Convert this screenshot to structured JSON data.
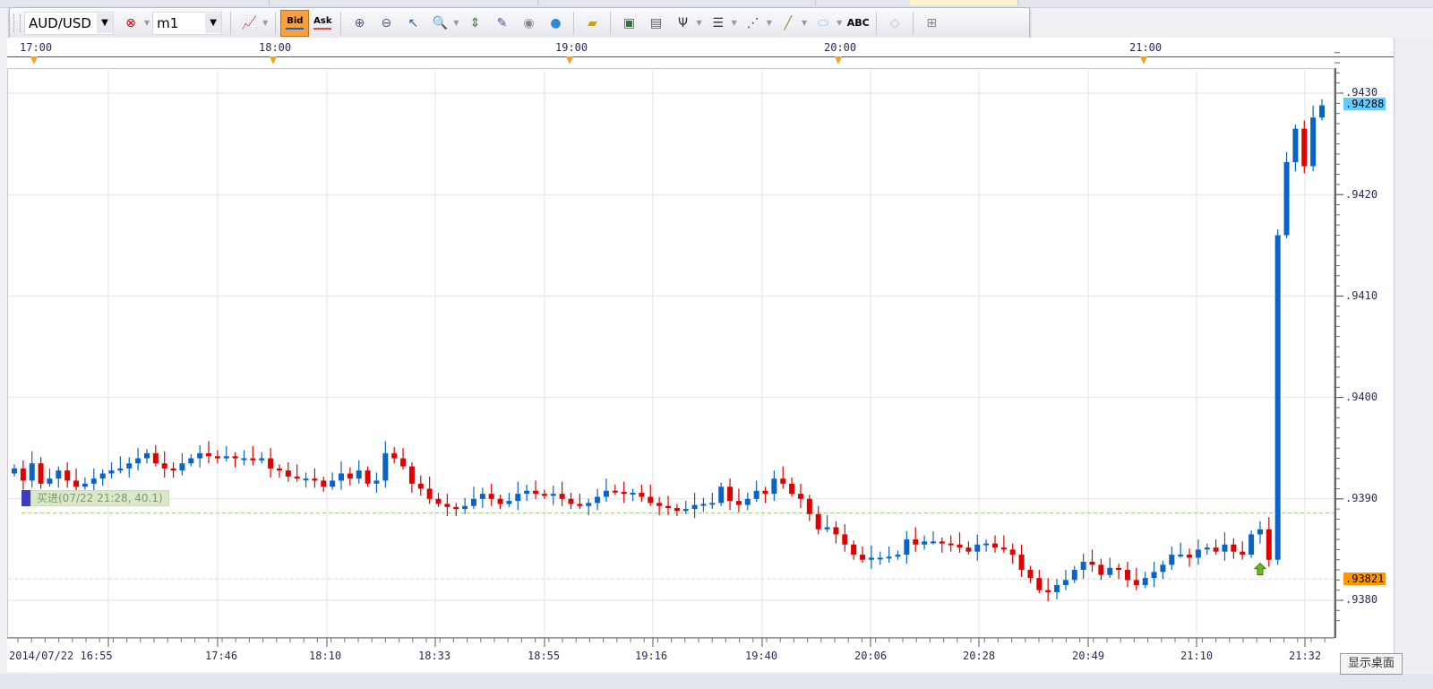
{
  "toolbar": {
    "symbol": "AUD/USD",
    "timeframe": "m1",
    "bid_label": "Bid",
    "ask_label": "Ask",
    "icons": [
      "zoom-in-icon",
      "zoom-out-icon",
      "cursor-icon",
      "magnify-icon",
      "scroll-end-icon",
      "edit-icon",
      "eye-icon",
      "globe-icon",
      "ruler-icon",
      "add-chart-icon",
      "overlay-chart-icon",
      "pitchfork-icon",
      "fibonacci-icon",
      "fan-icon",
      "line-icon",
      "ellipse-icon",
      "text-icon",
      "eraser-icon",
      "hierarchy-icon"
    ],
    "abc_label": "ABC"
  },
  "colors": {
    "up": "#0a64c8",
    "down": "#e00000",
    "bid_tag": "#ff9800",
    "last_tag": "#66ccff",
    "order_line": "#9ccc7a"
  },
  "top_ruler": {
    "labels": [
      "17:00",
      "18:00",
      "19:00",
      "20:00",
      "21:00"
    ]
  },
  "order": {
    "label": "买进(07/22 21:28, 40.1)",
    "price": 0.93886
  },
  "price_tags": {
    "last": ".94288",
    "bid": ".93821"
  },
  "desktop_button": "显示桌面",
  "chart_data": {
    "type": "candlestick",
    "title": "AUD/USD m1",
    "x_tick_labels": [
      "2014/07/22 16:55",
      "17:46",
      "18:10",
      "18:33",
      "18:55",
      "19:16",
      "19:40",
      "20:06",
      "20:28",
      "20:49",
      "21:10",
      "21:32"
    ],
    "y_tick_labels": [
      ".9430",
      ".9420",
      ".9410",
      ".9400",
      ".9390",
      ".9380"
    ],
    "y_ticks": [
      0.943,
      0.942,
      0.941,
      0.94,
      0.939,
      0.938
    ],
    "first_open": 0.93925,
    "closes": [
      0.9393,
      0.93918,
      0.93935,
      0.93915,
      0.9392,
      0.93928,
      0.93918,
      0.93912,
      0.93915,
      0.9392,
      0.93925,
      0.93928,
      0.9393,
      0.93935,
      0.9394,
      0.93945,
      0.93935,
      0.9393,
      0.93928,
      0.93935,
      0.9394,
      0.93945,
      0.93942,
      0.9394,
      0.93942,
      0.9394,
      0.9394,
      0.93938,
      0.9394,
      0.9393,
      0.93928,
      0.93922,
      0.9392,
      0.9392,
      0.93918,
      0.93912,
      0.93918,
      0.93925,
      0.9392,
      0.93928,
      0.93915,
      0.93918,
      0.93945,
      0.9394,
      0.93932,
      0.93915,
      0.9391,
      0.939,
      0.93895,
      0.93892,
      0.9389,
      0.93893,
      0.939,
      0.93905,
      0.939,
      0.93895,
      0.93898,
      0.93905,
      0.93908,
      0.93905,
      0.93903,
      0.93905,
      0.939,
      0.93895,
      0.93893,
      0.93896,
      0.93902,
      0.93908,
      0.93907,
      0.93905,
      0.93906,
      0.93902,
      0.93896,
      0.93893,
      0.93891,
      0.93888,
      0.9389,
      0.93894,
      0.93895,
      0.93896,
      0.93912,
      0.93898,
      0.93894,
      0.939,
      0.93908,
      0.93905,
      0.9392,
      0.93915,
      0.93905,
      0.939,
      0.93885,
      0.9387,
      0.93872,
      0.93865,
      0.93855,
      0.93845,
      0.9384,
      0.93842,
      0.93842,
      0.93843,
      0.93845,
      0.9386,
      0.93855,
      0.93858,
      0.93858,
      0.93856,
      0.93855,
      0.93852,
      0.93848,
      0.93855,
      0.93856,
      0.93852,
      0.9385,
      0.93845,
      0.9383,
      0.93822,
      0.9381,
      0.93808,
      0.93815,
      0.9382,
      0.9383,
      0.93838,
      0.93835,
      0.93825,
      0.93832,
      0.9383,
      0.9382,
      0.93815,
      0.93822,
      0.93828,
      0.93835,
      0.93845,
      0.93845,
      0.93842,
      0.9385,
      0.93852,
      0.93848,
      0.93855,
      0.93848,
      0.93845,
      0.93865,
      0.9387,
      0.9384,
      0.9416,
      0.94232,
      0.94265,
      0.94228,
      0.94276,
      0.94288
    ],
    "bid": 0.93821,
    "last": 0.94288,
    "ylim": [
      0.93776,
      0.94336
    ]
  }
}
